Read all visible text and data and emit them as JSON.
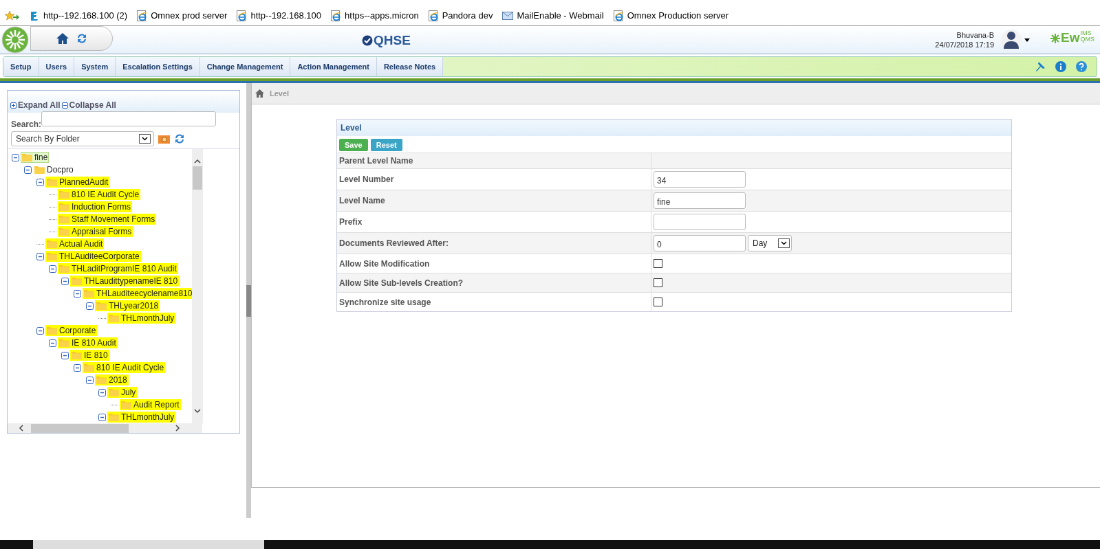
{
  "bookmarks": [
    {
      "kind": "edge",
      "label": "http--192.168.100 (2)"
    },
    {
      "kind": "ie",
      "label": "Omnex prod server"
    },
    {
      "kind": "ie",
      "label": "http--192.168.100"
    },
    {
      "kind": "ie",
      "label": "https--apps.micron"
    },
    {
      "kind": "ie",
      "label": "Pandora dev"
    },
    {
      "kind": "mail",
      "label": "MailEnable - Webmail"
    },
    {
      "kind": "ie",
      "label": "Omnex Production server"
    }
  ],
  "header": {
    "app_logo": "QHSE",
    "user_name": "Bhuvana-B",
    "datetime": "24/07/2018 17:19",
    "brand": {
      "text": "Ew",
      "sup": "IMS",
      "sub": "QMS"
    }
  },
  "menu": [
    "Setup",
    "Users",
    "System",
    "Escalation Settings",
    "Change Management",
    "Action Management",
    "Release Notes"
  ],
  "tree_panel": {
    "expand_all": "Expand All",
    "collapse_all": "Collapse All",
    "search_label": "Search:",
    "search_by": "Search By Folder",
    "tree": [
      {
        "label": "fine",
        "selected": true,
        "highlighted": false,
        "expanded": true,
        "children": [
          {
            "label": "Docpro",
            "selected": false,
            "highlighted": false,
            "expanded": true,
            "children": [
              {
                "label": "PlannedAudit",
                "selected": false,
                "highlighted": true,
                "expanded": true,
                "children": [
                  {
                    "label": "810 IE Audit Cycle",
                    "selected": false,
                    "highlighted": true
                  },
                  {
                    "label": "Induction Forms",
                    "selected": false,
                    "highlighted": true
                  },
                  {
                    "label": "Staff Movement Forms",
                    "selected": false,
                    "highlighted": true
                  },
                  {
                    "label": "Appraisal Forms",
                    "selected": false,
                    "highlighted": true
                  }
                ]
              },
              {
                "label": "Actual Audit",
                "selected": false,
                "highlighted": true
              },
              {
                "label": "THLAuditeeCorporate",
                "selected": false,
                "highlighted": true,
                "expanded": true,
                "children": [
                  {
                    "label": "THLaditProgramIE 810 Audit",
                    "selected": false,
                    "highlighted": true,
                    "expanded": true,
                    "children": [
                      {
                        "label": "THLaudittypenameIE 810",
                        "selected": false,
                        "highlighted": true,
                        "expanded": true,
                        "children": [
                          {
                            "label": "THLauditeecyclename810",
                            "selected": false,
                            "highlighted": true,
                            "expanded": true,
                            "children": [
                              {
                                "label": "THLyear2018",
                                "selected": false,
                                "highlighted": true,
                                "expanded": true,
                                "children": [
                                  {
                                    "label": "THLmonthJuly",
                                    "selected": false,
                                    "highlighted": true
                                  }
                                ]
                              }
                            ]
                          }
                        ]
                      }
                    ]
                  }
                ]
              },
              {
                "label": "Corporate",
                "selected": false,
                "highlighted": true,
                "expanded": true,
                "children": [
                  {
                    "label": "IE 810 Audit",
                    "selected": false,
                    "highlighted": true,
                    "expanded": true,
                    "children": [
                      {
                        "label": "IE 810",
                        "selected": false,
                        "highlighted": true,
                        "expanded": true,
                        "children": [
                          {
                            "label": "810 IE Audit Cycle",
                            "selected": false,
                            "highlighted": true,
                            "expanded": true,
                            "children": [
                              {
                                "label": "2018",
                                "selected": false,
                                "highlighted": true,
                                "expanded": true,
                                "children": [
                                  {
                                    "label": "July",
                                    "selected": false,
                                    "highlighted": true,
                                    "expanded": true,
                                    "children": [
                                      {
                                        "label": "Audit Report",
                                        "selected": false,
                                        "highlighted": true
                                      }
                                    ]
                                  },
                                  {
                                    "label": "THLmonthJuly",
                                    "selected": false,
                                    "highlighted": true,
                                    "expanded": true
                                  }
                                ]
                              }
                            ]
                          }
                        ]
                      }
                    ]
                  }
                ]
              }
            ]
          }
        ]
      }
    ]
  },
  "breadcrumb": [
    "Level"
  ],
  "form": {
    "title": "Level",
    "buttons": [
      {
        "kind": "save",
        "label": "Save"
      },
      {
        "kind": "reset",
        "label": "Reset"
      }
    ],
    "rows": [
      {
        "kind": "label",
        "label": "Parent Level Name"
      },
      {
        "kind": "input",
        "label": "Level Number",
        "value": "34"
      },
      {
        "kind": "input",
        "label": "Level Name",
        "value": "fine"
      },
      {
        "kind": "input",
        "label": "Prefix"
      },
      {
        "kind": "input_select",
        "label": "Documents Reviewed After:",
        "value": "0",
        "option": "Day"
      },
      {
        "kind": "checkbox",
        "label": "Allow Site Modification",
        "checked": false
      },
      {
        "kind": "checkbox",
        "label": "Allow Site Sub-levels Creation?",
        "checked": false
      },
      {
        "kind": "checkbox",
        "label": "Synchronize site usage",
        "checked": false
      }
    ]
  }
}
